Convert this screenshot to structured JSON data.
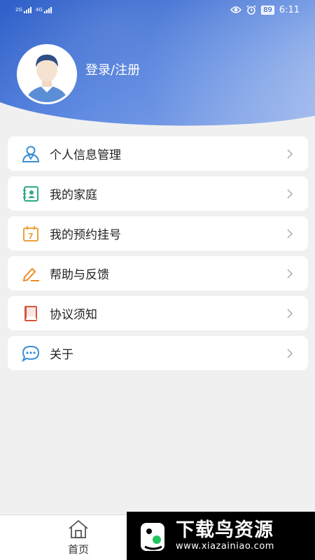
{
  "status_bar": {
    "signal1": "2G",
    "signal2": "4G",
    "battery": "89",
    "time": "6:11"
  },
  "profile": {
    "login_text": "登录/注册"
  },
  "menu": {
    "items": [
      {
        "label": "个人信息管理",
        "icon": "person-icon",
        "color": "#3a8fd6"
      },
      {
        "label": "我的家庭",
        "icon": "family-card-icon",
        "color": "#2fa98a"
      },
      {
        "label": "我的预约挂号",
        "icon": "calendar-icon",
        "color": "#e9a23b"
      },
      {
        "label": "帮助与反馈",
        "icon": "pencil-icon",
        "color": "#ee8a2a"
      },
      {
        "label": "协议须知",
        "icon": "book-icon",
        "color": "#d6553a"
      },
      {
        "label": "关于",
        "icon": "chat-icon",
        "color": "#3a8fd6"
      }
    ]
  },
  "tabbar": {
    "home_label": "首页"
  },
  "watermark": {
    "title": "下载鸟资源",
    "url": "www.xiazainiao.com"
  }
}
